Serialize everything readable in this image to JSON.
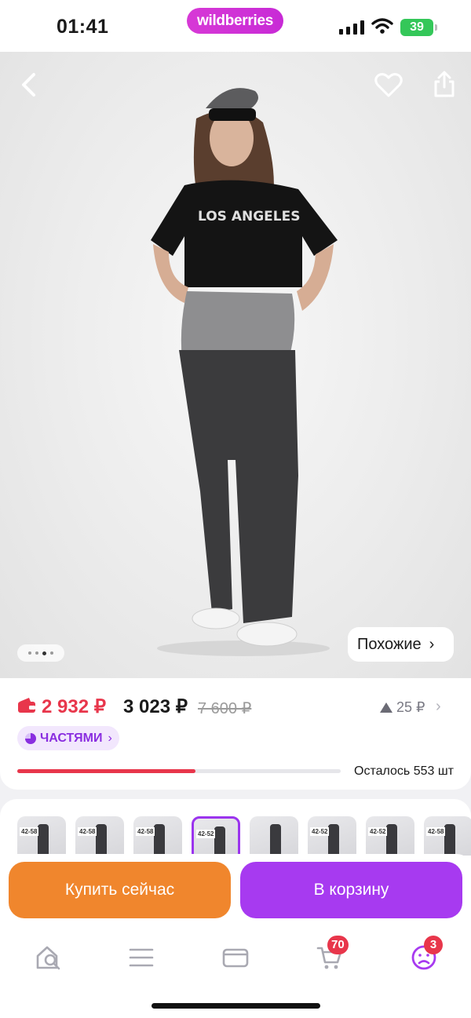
{
  "status_bar": {
    "time": "01:41",
    "brand": "wildberries",
    "battery": "39"
  },
  "hero": {
    "icons": [
      "back-icon",
      "heart-icon",
      "share-icon"
    ],
    "similar_label": "Похожие",
    "similar_chevron": "›",
    "gallery_dots": 4,
    "gallery_active_index": 2
  },
  "price": {
    "wallet_price": "2 932 ₽",
    "price": "3 023 ₽",
    "old_price": "7 600 ₽",
    "change": "25 ₽",
    "change_chevron": "›",
    "installments_label": "ЧАСТЯМИ",
    "installments_chevron": "›",
    "stock_text": "Осталось 553 шт",
    "stock_fraction": 0.55
  },
  "thumbnails": [
    {
      "tag": "42-58"
    },
    {
      "tag": "42-58"
    },
    {
      "tag": "42-58"
    },
    {
      "tag": "42-52",
      "selected": true
    },
    {
      "tag": ""
    },
    {
      "tag": "42-52"
    },
    {
      "tag": "42-52"
    },
    {
      "tag": "42-58"
    }
  ],
  "actions": {
    "buy_now": "Купить сейчас",
    "add_to_cart": "В корзину"
  },
  "bottom_nav": {
    "items": [
      "home-search-icon",
      "catalog-icon",
      "wallet-icon",
      "cart-icon",
      "profile-icon"
    ],
    "cart_badge": "70",
    "profile_badge": "3"
  },
  "colors": {
    "brand": "#cb30d6",
    "price_red": "#e8364b",
    "buy_now_orange": "#f0862d",
    "cart_purple": "#a73af0",
    "installments_purple": "#8a2ee0"
  }
}
